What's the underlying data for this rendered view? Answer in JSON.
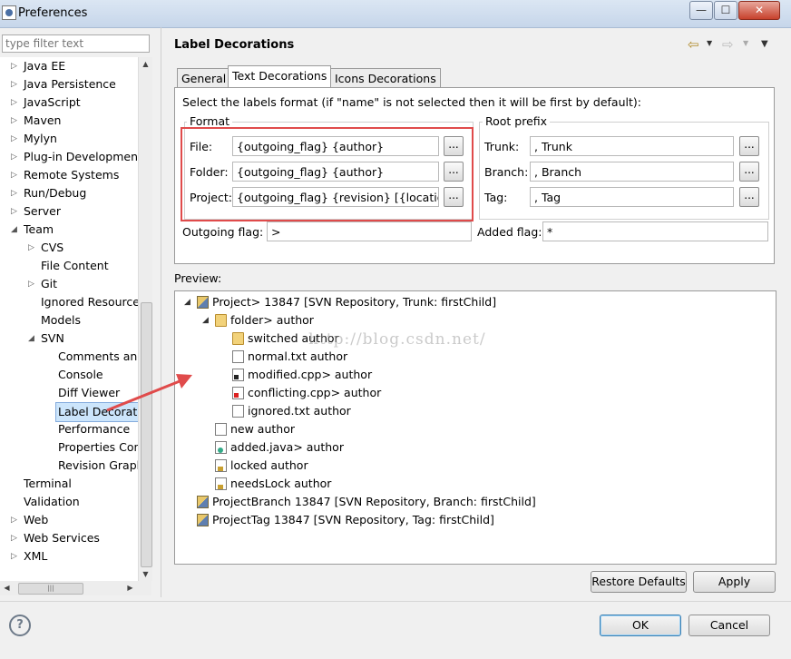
{
  "window": {
    "title": "Preferences",
    "btn_min": "—",
    "btn_max": "☐",
    "btn_close": "✕"
  },
  "filter": {
    "placeholder": "type filter text"
  },
  "tree": [
    {
      "label": "Java EE",
      "level": 0,
      "arrow": "▷"
    },
    {
      "label": "Java Persistence",
      "level": 0,
      "arrow": "▷"
    },
    {
      "label": "JavaScript",
      "level": 0,
      "arrow": "▷"
    },
    {
      "label": "Maven",
      "level": 0,
      "arrow": "▷"
    },
    {
      "label": "Mylyn",
      "level": 0,
      "arrow": "▷"
    },
    {
      "label": "Plug-in Development",
      "level": 0,
      "arrow": "▷"
    },
    {
      "label": "Remote Systems",
      "level": 0,
      "arrow": "▷"
    },
    {
      "label": "Run/Debug",
      "level": 0,
      "arrow": "▷"
    },
    {
      "label": "Server",
      "level": 0,
      "arrow": "▷"
    },
    {
      "label": "Team",
      "level": 0,
      "arrow": "◢"
    },
    {
      "label": "CVS",
      "level": 1,
      "arrow": "▷"
    },
    {
      "label": "File Content",
      "level": 1,
      "arrow": ""
    },
    {
      "label": "Git",
      "level": 1,
      "arrow": "▷"
    },
    {
      "label": "Ignored Resources",
      "level": 1,
      "arrow": ""
    },
    {
      "label": "Models",
      "level": 1,
      "arrow": ""
    },
    {
      "label": "SVN",
      "level": 1,
      "arrow": "◢"
    },
    {
      "label": "Comments and",
      "level": 2,
      "arrow": ""
    },
    {
      "label": "Console",
      "level": 2,
      "arrow": ""
    },
    {
      "label": "Diff Viewer",
      "level": 2,
      "arrow": ""
    },
    {
      "label": "Label Decorations",
      "level": 2,
      "arrow": "",
      "selected": true
    },
    {
      "label": "Performance",
      "level": 2,
      "arrow": ""
    },
    {
      "label": "Properties Con",
      "level": 2,
      "arrow": ""
    },
    {
      "label": "Revision Graph",
      "level": 2,
      "arrow": ""
    },
    {
      "label": "Terminal",
      "level": 0,
      "arrow": ""
    },
    {
      "label": "Validation",
      "level": 0,
      "arrow": ""
    },
    {
      "label": "Web",
      "level": 0,
      "arrow": "▷"
    },
    {
      "label": "Web Services",
      "level": 0,
      "arrow": "▷"
    },
    {
      "label": "XML",
      "level": 0,
      "arrow": "▷"
    }
  ],
  "page": {
    "title": "Label Decorations",
    "tabs": [
      "General",
      "Text Decorations",
      "Icons Decorations"
    ],
    "instruction": "Select the labels format (if \"name\" is not selected then it will be first by default):",
    "format_group": "Format",
    "root_group": "Root prefix",
    "file_label": "File:",
    "file_value": "{outgoing_flag} {author}",
    "folder_label": "Folder:",
    "folder_value": "{outgoing_flag} {author}",
    "project_label": "Project:",
    "project_value": "{outgoing_flag} {revision} [{location_la",
    "trunk_label": "Trunk:",
    "trunk_value": ", Trunk",
    "branch_label": "Branch:",
    "branch_value": ", Branch",
    "tag_label": "Tag:",
    "tag_value": ", Tag",
    "dots": "...",
    "outgoing_label": "Outgoing flag:",
    "outgoing_value": ">",
    "added_label": "Added flag:",
    "added_value": "*"
  },
  "preview": {
    "label": "Preview:",
    "watermark": "http://blog.csdn.net/",
    "items": [
      {
        "text": "Project> 13847 [SVN Repository, Trunk: firstChild]",
        "icon": "project",
        "level": 0,
        "arrow": "◢"
      },
      {
        "text": "folder> author",
        "icon": "folder",
        "level": 1,
        "arrow": "◢"
      },
      {
        "text": "switched author",
        "icon": "folder",
        "level": 2,
        "arrow": ""
      },
      {
        "text": "normal.txt author",
        "icon": "file",
        "level": 2,
        "arrow": ""
      },
      {
        "text": "modified.cpp> author",
        "icon": "file mod",
        "level": 2,
        "arrow": ""
      },
      {
        "text": "conflicting.cpp> author",
        "icon": "file conf",
        "level": 2,
        "arrow": ""
      },
      {
        "text": "ignored.txt author",
        "icon": "file",
        "level": 2,
        "arrow": ""
      },
      {
        "text": "new author",
        "icon": "file",
        "level": 1,
        "arrow": ""
      },
      {
        "text": "added.java> author",
        "icon": "file add",
        "level": 1,
        "arrow": ""
      },
      {
        "text": "locked author",
        "icon": "file lock",
        "level": 1,
        "arrow": ""
      },
      {
        "text": "needsLock author",
        "icon": "file lock",
        "level": 1,
        "arrow": ""
      },
      {
        "text": "ProjectBranch 13847 [SVN Repository, Branch: firstChild]",
        "icon": "project",
        "level": 0,
        "arrow": ""
      },
      {
        "text": "ProjectTag 13847 [SVN Repository, Tag: firstChild]",
        "icon": "project",
        "level": 0,
        "arrow": ""
      }
    ]
  },
  "buttons": {
    "restore": "Restore Defaults",
    "apply": "Apply",
    "ok": "OK",
    "cancel": "Cancel",
    "help": "?"
  },
  "colors": {
    "annotation_red": "#e04b4b"
  }
}
